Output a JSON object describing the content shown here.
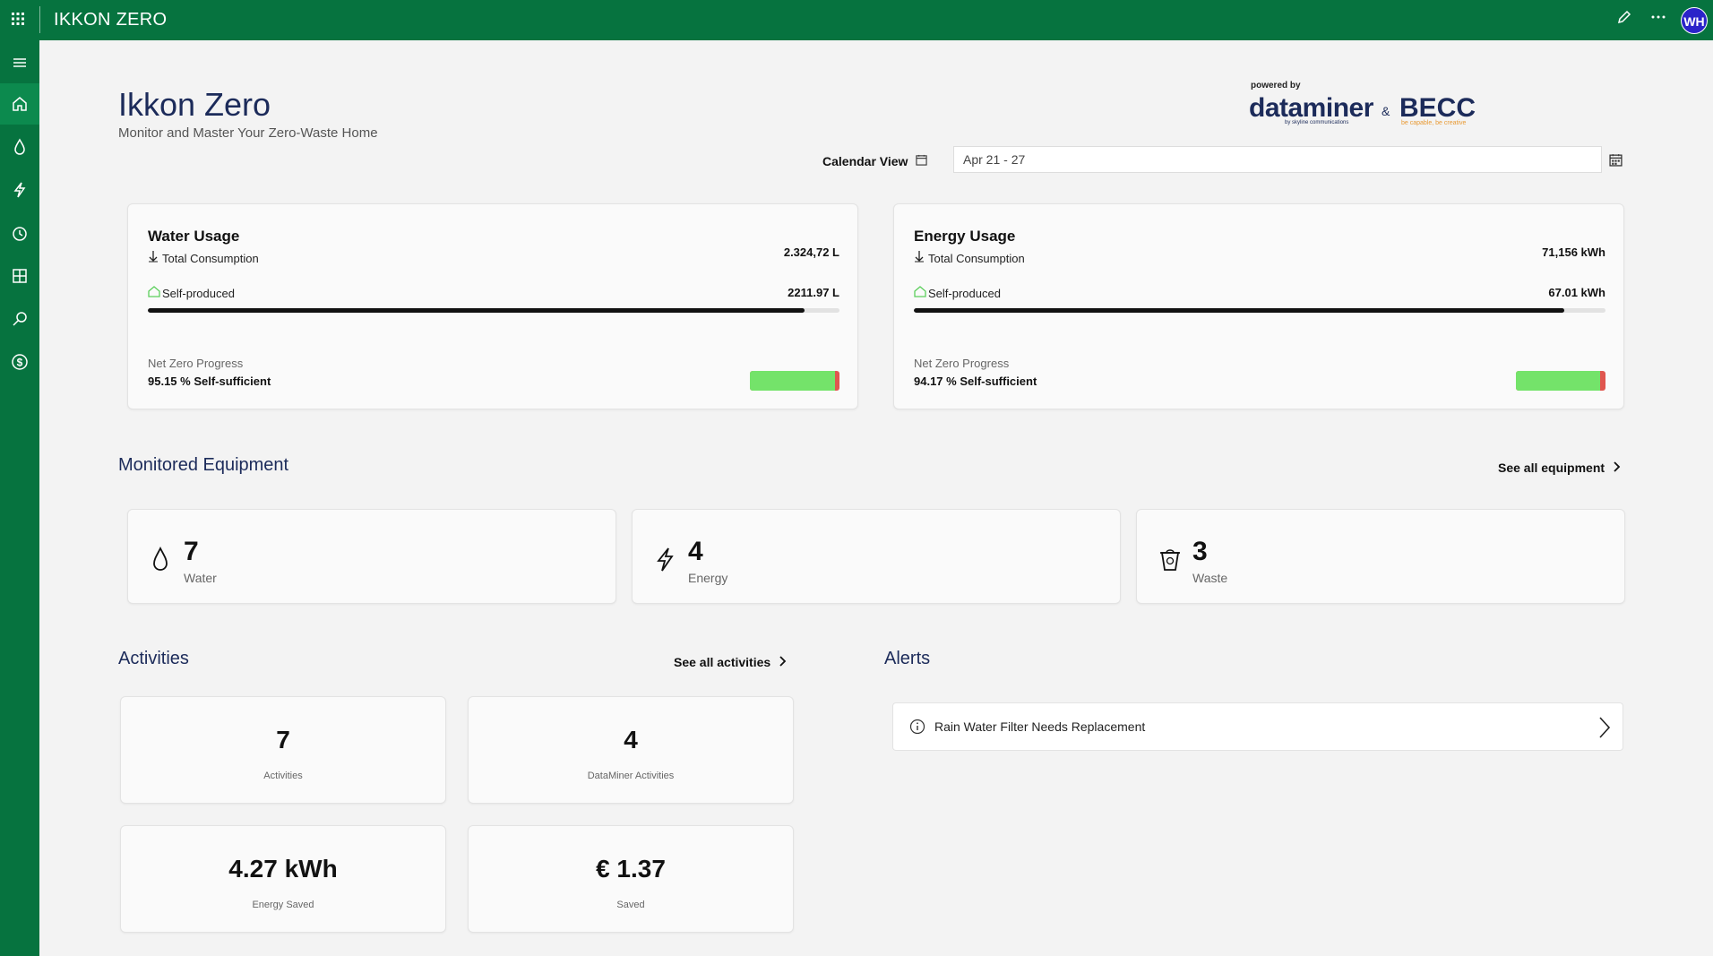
{
  "app": {
    "title": "IKKON ZERO",
    "avatar": "WH"
  },
  "colors": {
    "brand_green": "#06733f",
    "accent_navy": "#1c2b5a",
    "progress_green": "#74e36a",
    "progress_red": "#e0564f",
    "avatar_blue": "#2a23c9"
  },
  "icons": {
    "top": [
      "apps-grid-icon",
      "edit-pencil-icon",
      "more-dots-icon"
    ],
    "sidebar": [
      "menu-icon",
      "home-icon",
      "water-drop-icon",
      "lightning-icon",
      "clock-icon",
      "grid-icon",
      "search-icon",
      "dollar-icon"
    ]
  },
  "header": {
    "title": "Ikkon Zero",
    "subtitle": "Monitor and Master Your Zero-Waste Home"
  },
  "logo": {
    "powered_by": "powered by",
    "dataminer": "dataminer",
    "dataminer_sub": "by skyline communications",
    "amp": "&",
    "becc": "BECC",
    "becc_sub": "be capable, be creative"
  },
  "calendar": {
    "label": "Calendar View",
    "date_range": "Apr 21 - 27"
  },
  "water": {
    "title": "Water Usage",
    "total_label": "Total Consumption",
    "total_value": "2.324,72 L",
    "self_label": "Self-produced",
    "self_value": "2211.97 L",
    "self_fraction": 0.95,
    "net_zero_label": "Net Zero Progress",
    "net_zero_value": "95.15 % Self-sufficient",
    "net_zero_fraction": 0.9515
  },
  "energy": {
    "title": "Energy Usage",
    "total_label": "Total Consumption",
    "total_value": "71,156 kWh",
    "self_label": "Self-produced",
    "self_value": "67.01 kWh",
    "self_fraction": 0.94,
    "net_zero_label": "Net Zero Progress",
    "net_zero_value": "94.17 % Self-sufficient",
    "net_zero_fraction": 0.9417
  },
  "equipment": {
    "title": "Monitored Equipment",
    "see_all": "See all equipment",
    "items": [
      {
        "count": "7",
        "label": "Water",
        "icon": "water-drop-icon"
      },
      {
        "count": "4",
        "label": "Energy",
        "icon": "lightning-icon"
      },
      {
        "count": "3",
        "label": "Waste",
        "icon": "recycle-bin-icon"
      }
    ]
  },
  "activities": {
    "title": "Activities",
    "see_all": "See all activities",
    "items": [
      {
        "value": "7",
        "label": "Activities"
      },
      {
        "value": "4",
        "label": "DataMiner Activities"
      },
      {
        "value": "4.27 kWh",
        "label": "Energy Saved"
      },
      {
        "value": "€ 1.37",
        "label": "Saved"
      }
    ]
  },
  "alerts": {
    "title": "Alerts",
    "items": [
      {
        "text": "Rain Water Filter Needs Replacement",
        "icon": "info-icon"
      }
    ]
  }
}
